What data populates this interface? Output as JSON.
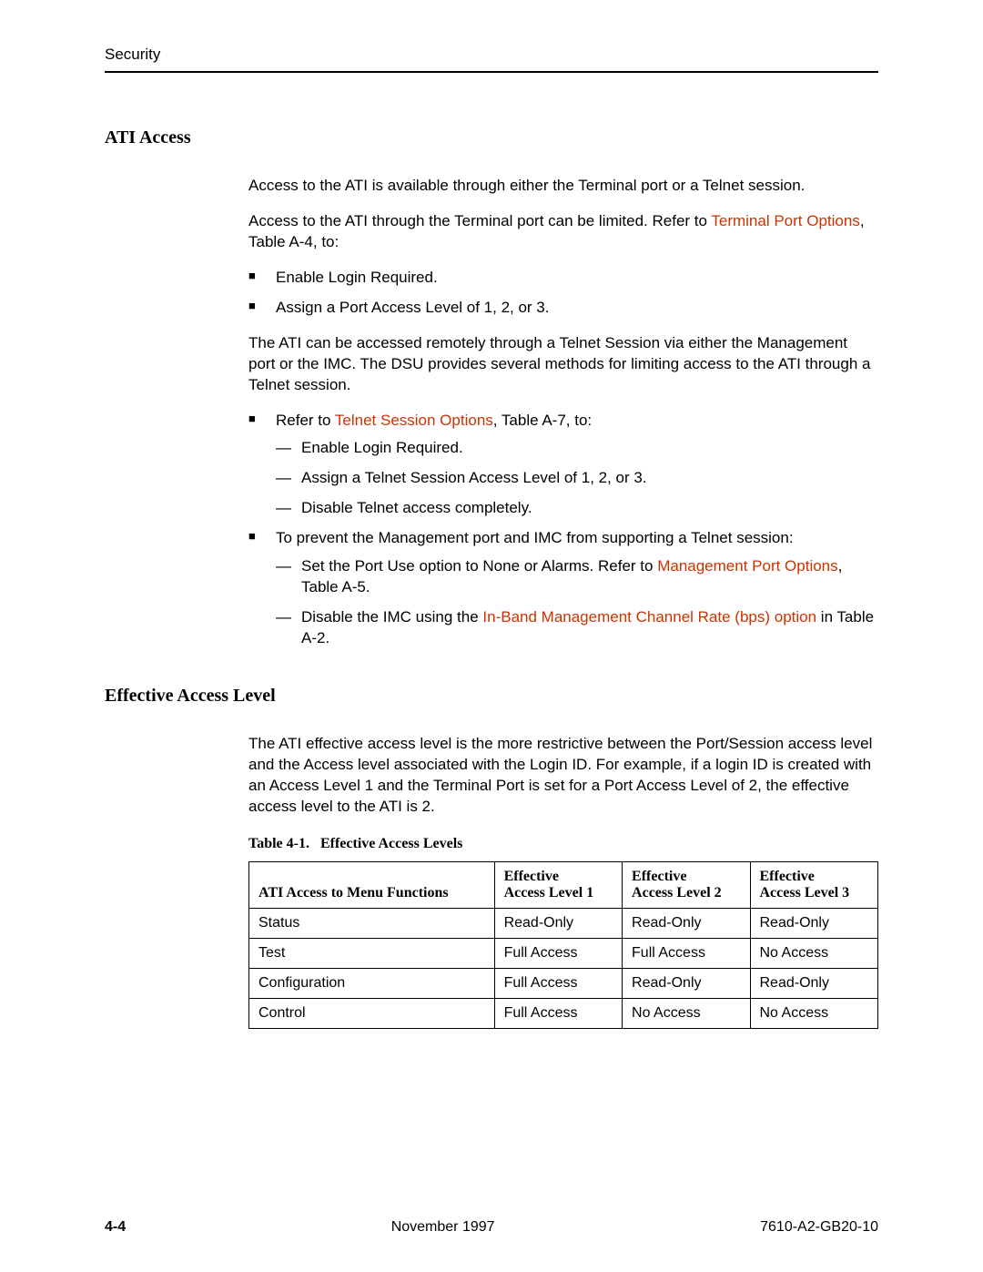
{
  "header": {
    "title": "Security"
  },
  "sections": {
    "atiAccess": {
      "heading": "ATI Access",
      "para1": "Access to the ATI is available through either the Terminal port or a Telnet session.",
      "para2_part1": "Access to the ATI through the Terminal port can be limited. Refer to ",
      "para2_link": "Terminal Port Options",
      "para2_part2": ", Table A-4, to:",
      "list1": {
        "item1": "Enable Login Required.",
        "item2": "Assign a Port Access Level of 1, 2, or 3."
      },
      "para3": "The ATI can be accessed remotely through a Telnet Session via either the Management port or the IMC. The DSU provides several methods for limiting access to the ATI through a Telnet session.",
      "list2": {
        "item1_part1": "Refer to ",
        "item1_link": "Telnet Session Options",
        "item1_part2": ", Table A-7, to:",
        "sub1": {
          "a": "Enable Login Required.",
          "b": "Assign a Telnet Session Access Level of 1, 2, or 3.",
          "c": "Disable Telnet access completely."
        },
        "item2": "To prevent the Management port and IMC from supporting a Telnet session:",
        "sub2": {
          "a_part1": "Set the Port Use option to None or Alarms. Refer to ",
          "a_link": "Management Port Options",
          "a_part2": ", Table A-5.",
          "b_part1": "Disable the IMC using the ",
          "b_link": "In-Band Management Channel Rate (bps) option",
          "b_part2": " in Table A-2."
        }
      }
    },
    "effectiveAccess": {
      "heading": "Effective Access Level",
      "para": "The ATI effective access level is the more restrictive between the Port/Session access level and the Access level associated with the Login ID. For example, if a login ID is created with an Access Level 1 and the Terminal Port is set for a Port Access Level of 2, the effective access level to the ATI is 2.",
      "tableTitle": "Table 4-1.   Effective Access Levels"
    }
  },
  "table": {
    "headers": {
      "col1": "ATI Access to Menu Functions",
      "col2a": "Effective",
      "col2b": "Access Level 1",
      "col3a": "Effective",
      "col3b": "Access Level 2",
      "col4a": "Effective",
      "col4b": "Access Level 3"
    },
    "rows": [
      {
        "c1": "Status",
        "c2": "Read-Only",
        "c3": "Read-Only",
        "c4": "Read-Only"
      },
      {
        "c1": "Test",
        "c2": "Full Access",
        "c3": "Full Access",
        "c4": "No Access"
      },
      {
        "c1": "Configuration",
        "c2": "Full Access",
        "c3": "Read-Only",
        "c4": "Read-Only"
      },
      {
        "c1": "Control",
        "c2": "Full Access",
        "c3": "No Access",
        "c4": "No Access"
      }
    ]
  },
  "footer": {
    "left": "4-4",
    "center": "November 1997",
    "right": "7610-A2-GB20-10"
  }
}
